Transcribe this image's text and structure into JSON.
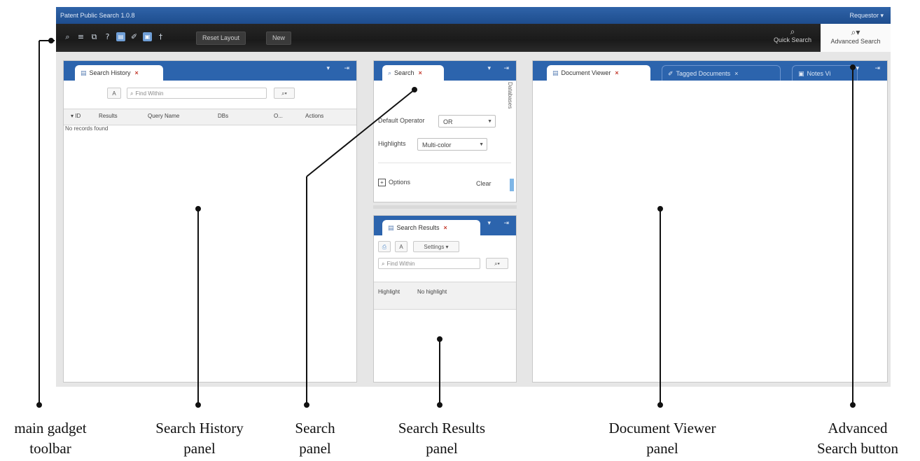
{
  "app": {
    "title": "Patent Public Search 1.0.8",
    "user": "Requestor ▾"
  },
  "toolbar": {
    "icons": [
      "search-icon",
      "list-icon",
      "copy-icon",
      "help-icon",
      "doc-icon",
      "tag-icon",
      "notes-icon",
      "pin-icon"
    ],
    "reset_layout": "Reset Layout",
    "new": "New",
    "quick_search": "Quick Search",
    "advanced_search": "Advanced Search"
  },
  "search_history": {
    "tab": "Search History",
    "find_placeholder": "Find Within",
    "columns": [
      "▾ ID",
      "Results",
      "Query Name",
      "DBs",
      "O...",
      "Actions"
    ],
    "empty": "No records found"
  },
  "search": {
    "tab": "Search",
    "side_label": "Databases",
    "default_operator_label": "Default Operator",
    "default_operator_value": "OR",
    "highlights_label": "Highlights",
    "highlights_value": "Multi-color",
    "options": "Options",
    "clear": "Clear"
  },
  "search_results": {
    "tab": "Search Results",
    "settings": "Settings ▾",
    "find_placeholder": "Find Within",
    "highlight_label": "Highlight",
    "highlight_value": "No highlight"
  },
  "document_viewer": {
    "tabs": [
      "Document Viewer",
      "Tagged Documents",
      "Notes Vi"
    ]
  },
  "callouts": {
    "main_toolbar": [
      "main gadget",
      "toolbar"
    ],
    "search_history": [
      "Search History",
      "panel"
    ],
    "search": [
      "Search",
      "panel"
    ],
    "search_results": [
      "Search Results",
      "panel"
    ],
    "document_viewer": [
      "Document Viewer",
      "panel"
    ],
    "advanced_search": [
      "Advanced",
      "Search button"
    ]
  }
}
